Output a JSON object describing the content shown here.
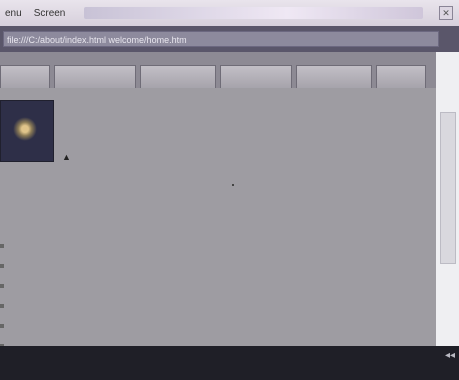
{
  "menubar": {
    "items": [
      "enu",
      "Screen"
    ]
  },
  "address": {
    "value": "file:///C:/about/index.html   welcome/home.htm"
  },
  "tabs": [
    "",
    "",
    "",
    "",
    "",
    ""
  ],
  "content": {
    "breadcrumb": "",
    "heading": "",
    "paragraph": "",
    "list_items": [
      "",
      "",
      "",
      "",
      "",
      ""
    ]
  },
  "statusbar": {
    "text": "",
    "icons": "◂◂"
  },
  "colors": {
    "frame": "#2b2b33",
    "content_bg": "#9e9ca2",
    "address_bg": "#5a566a"
  }
}
